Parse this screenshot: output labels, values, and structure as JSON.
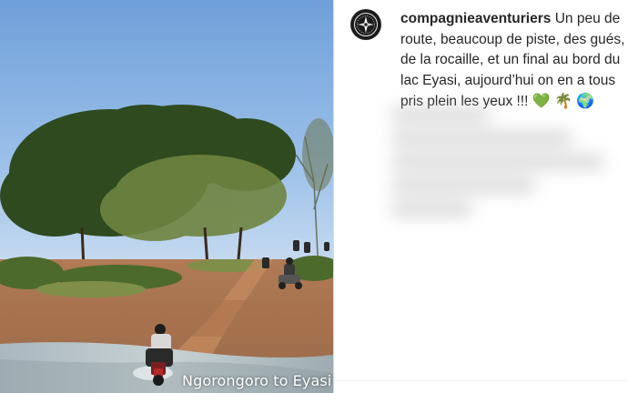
{
  "post": {
    "username": "compagnieaventuriers",
    "caption_text": "Un peu de route, beaucoup de piste, des gués, de la rocaille, et un final au bord du lac Eyasi, aujourd’hui on en a tous pris plein les yeux !!!",
    "emojis": [
      "💚",
      "🌴",
      "🌍"
    ]
  },
  "video": {
    "overlay_text": "Ngorongoro to Eyasi"
  },
  "icons": {
    "avatar": "compass-logo-icon"
  }
}
